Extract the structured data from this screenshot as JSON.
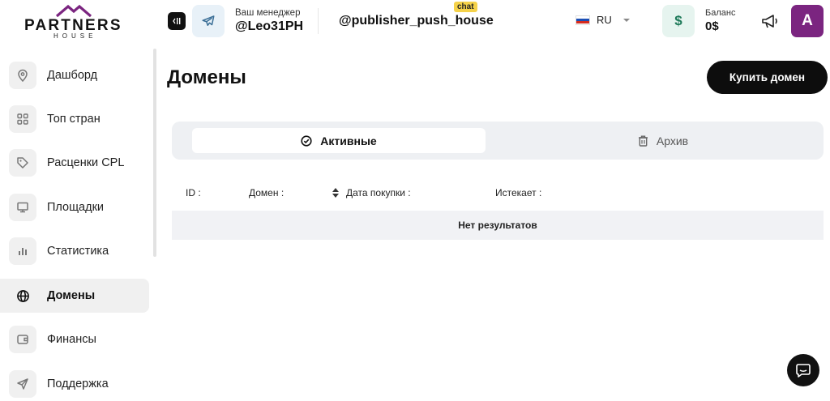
{
  "brand": {
    "wordmark": "PARTNERS",
    "sub": "HOUSE",
    "roof_color": "#7b2580"
  },
  "header": {
    "manager_label": "Ваш менеджер",
    "manager_name": "@Leo31PH",
    "chat_name": "@publisher_push_house",
    "chat_badge": "chat",
    "language": "RU",
    "balance_label": "Баланс",
    "balance_value": "0$",
    "balance_icon": "$",
    "avatar_letter": "A",
    "icons": [
      "sidebar-toggle-icon",
      "telegram-icon",
      "flag-ru-icon",
      "chevron-down-icon",
      "dollar-icon",
      "megaphone-icon"
    ]
  },
  "sidebar": {
    "items": [
      {
        "label": "Дашборд",
        "icon": "map-pin-icon",
        "active": false
      },
      {
        "label": "Топ стран",
        "icon": "grid-icon",
        "active": false
      },
      {
        "label": "Расценки CPL",
        "icon": "tag-icon",
        "active": false
      },
      {
        "label": "Площадки",
        "icon": "monitor-icon",
        "active": false
      },
      {
        "label": "Статистика",
        "icon": "bar-chart-icon",
        "active": false
      },
      {
        "label": "Домены",
        "icon": "globe-icon",
        "active": true
      },
      {
        "label": "Финансы",
        "icon": "wallet-icon",
        "active": false
      },
      {
        "label": "Поддержка",
        "icon": "send-icon",
        "active": false
      }
    ]
  },
  "main": {
    "title": "Домены",
    "buy_button": "Купить домен",
    "tabs": [
      {
        "label": "Активные",
        "icon": "check-circle-icon",
        "active": true
      },
      {
        "label": "Архив",
        "icon": "trash-icon",
        "active": false
      }
    ],
    "columns": [
      "ID :",
      "Домен :",
      "Дата покупки :",
      "Истекает :"
    ],
    "empty_text": "Нет результатов"
  },
  "colors": {
    "accent": "#7b2580",
    "primary_button": "#0d0d0d",
    "tabs_bg": "#eef0f3"
  }
}
